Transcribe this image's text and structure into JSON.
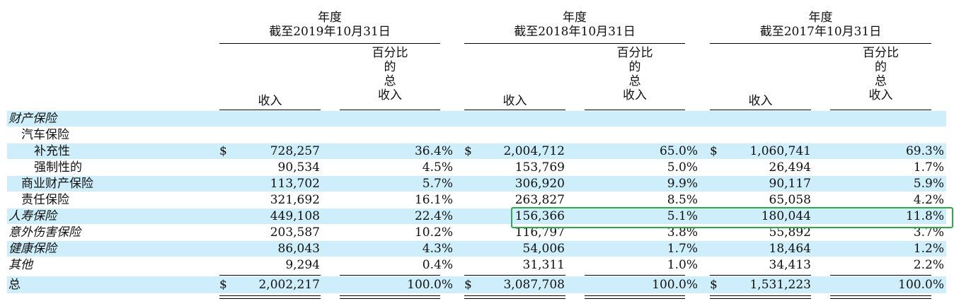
{
  "header": {
    "groups": [
      {
        "line1": "年度",
        "line2": "截至2019年10月31日"
      },
      {
        "line1": "年度",
        "line2": "截至2018年10月31日"
      },
      {
        "line1": "年度",
        "line2": "截至2017年10月31日"
      }
    ],
    "col_revenue": "收入",
    "col_pct": [
      "百分比",
      "的",
      "总",
      "收入"
    ]
  },
  "currency": "$",
  "rows": [
    {
      "label": "财产保险",
      "values": []
    },
    {
      "label": "汽车保险",
      "values": []
    },
    {
      "label": "补充性",
      "values": [
        "728,257",
        "36.4%",
        "2,004,712",
        "65.0%",
        "1,060,741",
        "69.3%"
      ]
    },
    {
      "label": "强制性的",
      "values": [
        "90,534",
        "4.5%",
        "153,769",
        "5.0%",
        "26,494",
        "1.7%"
      ]
    },
    {
      "label": "商业财产保险",
      "values": [
        "113,702",
        "5.7%",
        "306,920",
        "9.9%",
        "90,117",
        "5.9%"
      ]
    },
    {
      "label": "责任保险",
      "values": [
        "321,692",
        "16.1%",
        "263,827",
        "8.5%",
        "65,058",
        "4.2%"
      ]
    },
    {
      "label": "人寿保险",
      "values": [
        "449,108",
        "22.4%",
        "156,366",
        "5.1%",
        "180,044",
        "11.8%"
      ]
    },
    {
      "label": "意外伤害保险",
      "values": [
        "203,587",
        "10.2%",
        "116,797",
        "3.8%",
        "55,892",
        "3.7%"
      ]
    },
    {
      "label": "健康保险",
      "values": [
        "86,043",
        "4.3%",
        "54,006",
        "1.7%",
        "18,464",
        "1.2%"
      ]
    },
    {
      "label": "其他",
      "values": [
        "9,294",
        "0.4%",
        "31,311",
        "1.0%",
        "34,413",
        "2.2%"
      ]
    },
    {
      "label": "总",
      "values": [
        "2,002,217",
        "100.0%",
        "3,087,708",
        "100.0%",
        "1,531,223",
        "100.0%"
      ]
    }
  ],
  "colors": {
    "band": "#cdeefa",
    "highlight": "#2ea84a"
  }
}
